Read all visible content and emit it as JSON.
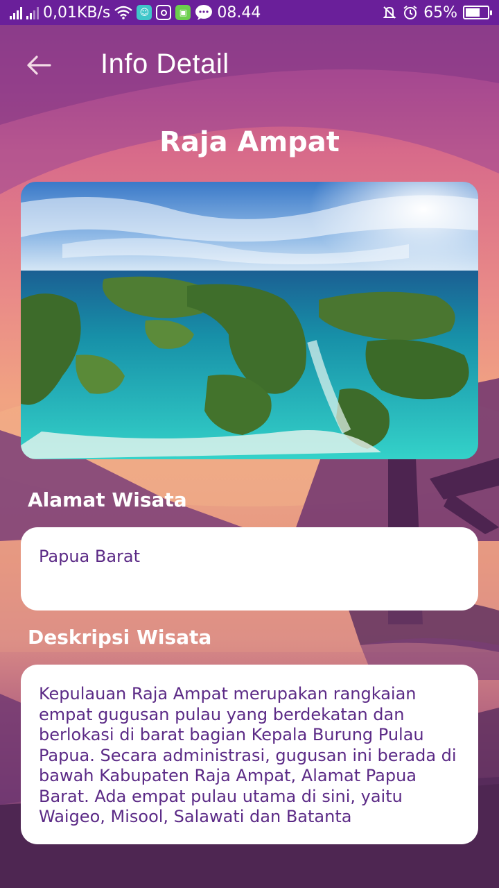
{
  "status_bar": {
    "network_speed": "0,01KB/s",
    "time": "08.44",
    "battery_percent": "65%",
    "battery_level": 0.65,
    "icons": [
      "signal-icon",
      "signal-icon",
      "wifi-icon",
      "app-notification-icon",
      "instagram-icon",
      "android-icon",
      "messages-icon",
      "mute-icon",
      "alarm-icon",
      "battery-icon"
    ]
  },
  "app_bar": {
    "title": "Info Detail",
    "back_icon": "arrow-left-icon"
  },
  "place": {
    "name": "Raja Ampat",
    "image_alt": "Raja Ampat aerial islands photo"
  },
  "address_section": {
    "label": "Alamat Wisata",
    "value": "Papua Barat"
  },
  "description_section": {
    "label": "Deskripsi Wisata",
    "value": "Kepulauan Raja Ampat merupakan rangkaian empat gugusan pulau yang berdekatan dan berlokasi di barat bagian Kepala Burung Pulau Papua. Secara administrasi, gugusan ini berada di bawah Kabupaten Raja Ampat, Alamat Papua Barat. Ada empat pulau utama di sini, yaitu Waigeo, Misool, Salawati dan Batanta"
  },
  "colors": {
    "status_bar": "#6a1f9a",
    "card_text": "#5b2a86",
    "card_bg": "#ffffff"
  }
}
